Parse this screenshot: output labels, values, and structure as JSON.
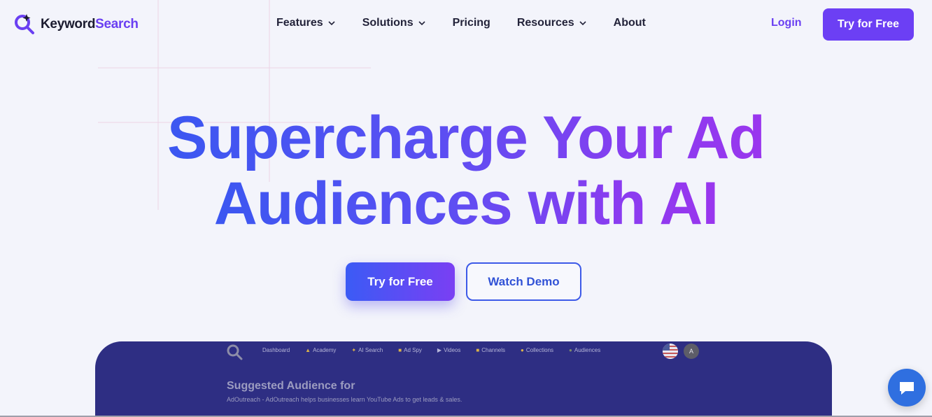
{
  "brand": {
    "name_part1": "Keyword",
    "name_part2": "Search",
    "accent": "#6a3ff2"
  },
  "nav": {
    "items": [
      {
        "label": "Features",
        "has_dropdown": true
      },
      {
        "label": "Solutions",
        "has_dropdown": true
      },
      {
        "label": "Pricing",
        "has_dropdown": false
      },
      {
        "label": "Resources",
        "has_dropdown": true
      },
      {
        "label": "About",
        "has_dropdown": false
      }
    ],
    "login": "Login",
    "cta": "Try for Free"
  },
  "hero": {
    "line1_a": "Supercharge Your Ad",
    "line2_a": "Audiences with AI",
    "primary_button": "Try for Free",
    "secondary_button": "Watch Demo",
    "gradient": [
      "#3b57f1",
      "#9a36ee"
    ]
  },
  "app_preview": {
    "nav": [
      {
        "label": "Dashboard",
        "icon": ""
      },
      {
        "label": "Academy",
        "icon": "academy-icon"
      },
      {
        "label": "AI Search",
        "icon": "ai-search-icon"
      },
      {
        "label": "Ad Spy",
        "icon": "ad-spy-icon"
      },
      {
        "label": "Videos",
        "icon": "play-icon"
      },
      {
        "label": "Channels",
        "icon": "channels-icon"
      },
      {
        "label": "Collections",
        "icon": "collections-icon"
      },
      {
        "label": "Audiences",
        "icon": "audiences-icon"
      }
    ],
    "avatar_initial": "A",
    "title": "Suggested Audience for",
    "subtitle": "AdOutreach - AdOutreach helps businesses learn YouTube Ads to get leads & sales.",
    "background": "#2e2e83"
  },
  "chat": {
    "icon": "chat-icon",
    "color": "#2f6fe0"
  }
}
